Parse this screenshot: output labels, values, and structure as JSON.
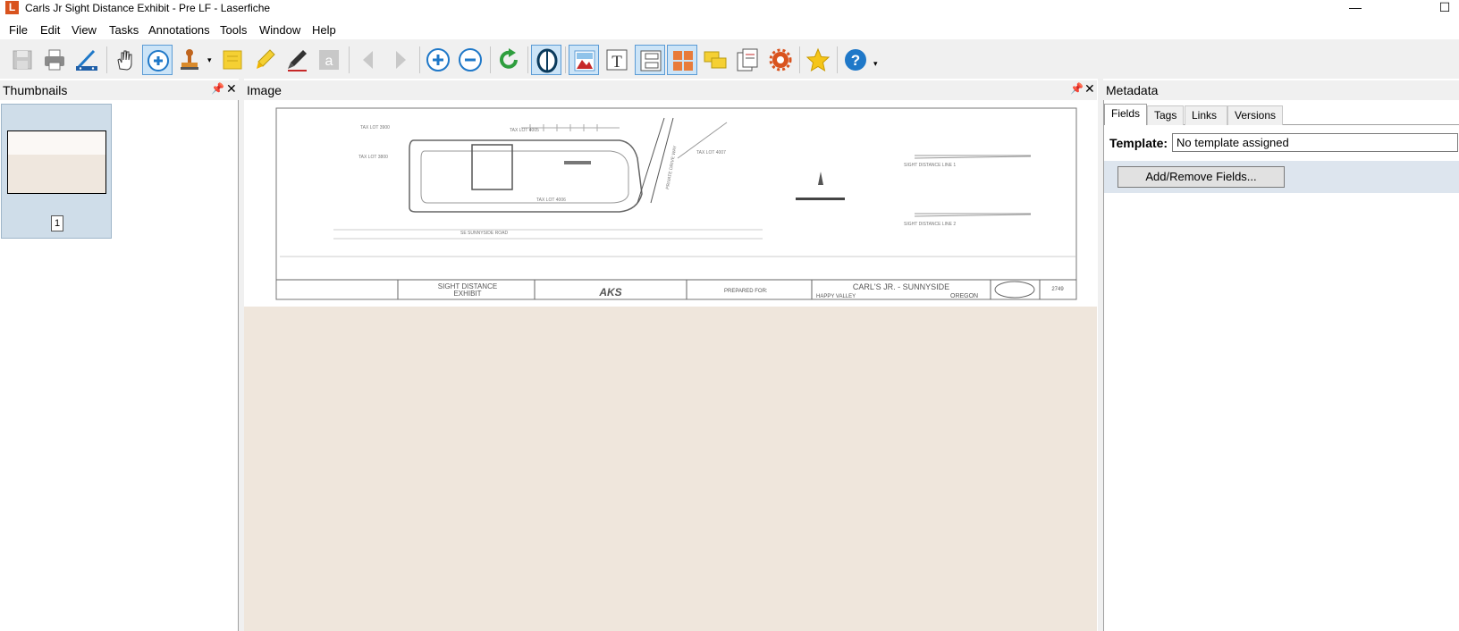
{
  "window": {
    "title": "Carls Jr Sight Distance Exhibit - Pre LF - Laserfiche",
    "app_icon_letter": "L",
    "minimize_glyph": "—",
    "maximize_glyph": "☐"
  },
  "menu": [
    "File",
    "Edit",
    "View",
    "Tasks",
    "Annotations",
    "Tools",
    "Window",
    "Help"
  ],
  "toolbar": {
    "buttons": [
      "save-icon",
      "print-icon",
      "scanner-icon",
      "pan-hand-icon",
      "zoom-tool-icon",
      "stamp-icon",
      "sticky-note-icon",
      "highlighter-icon",
      "pen-icon",
      "text-annotation-icon",
      "previous-page-icon",
      "next-page-icon",
      "zoom-in-icon",
      "zoom-out-icon",
      "rotate-icon",
      "ocr-icon",
      "image-view-icon",
      "text-view-icon",
      "split-view-icon",
      "thumbnail-view-icon",
      "annotations-pane-icon",
      "properties-pane-icon",
      "settings-icon",
      "favorites-star-icon",
      "help-icon"
    ]
  },
  "panels": {
    "thumbnails": {
      "title": "Thumbnails",
      "page_number": "1"
    },
    "image": {
      "title": "Image"
    },
    "metadata": {
      "title": "Metadata",
      "tabs": [
        "Fields",
        "Tags",
        "Links",
        "Versions"
      ],
      "template_label": "Template:",
      "template_value": "No template assigned",
      "add_remove_label": "Add/Remove Fields..."
    },
    "pin_glyph": "📌",
    "close_glyph": "✕"
  },
  "drawing": {
    "labels": {
      "tax_lot_3900": "TAX LOT 3900",
      "tax_lot_4005": "TAX LOT 4005",
      "tax_lot_3800": "TAX LOT 3800",
      "tax_lot_4007": "TAX LOT 4007",
      "tax_lot_4006": "TAX LOT 4006",
      "road": "SE SUNNYSIDE ROAD",
      "private_drive": "PRIVATE DRIVE WAY",
      "sight_distance": "SIGHT DISTANCE",
      "exhibit": "EXHIBIT",
      "prepared_for": "PREPARED FOR:",
      "project_title": "CARL'S JR. - SUNNYSIDE",
      "city": "HAPPY VALLEY",
      "state": "OREGON",
      "firm": "AKS",
      "job_number": "2749",
      "sight_line_1": "SIGHT DISTANCE LINE 1",
      "sight_line_2": "SIGHT DISTANCE LINE 2"
    }
  },
  "colors": {
    "chrome": "#f0f0f0",
    "selection": "#cfdde9",
    "page_background": "#efe6dc",
    "accent_blue": "#1f78c8",
    "app_orange": "#d9531e"
  }
}
